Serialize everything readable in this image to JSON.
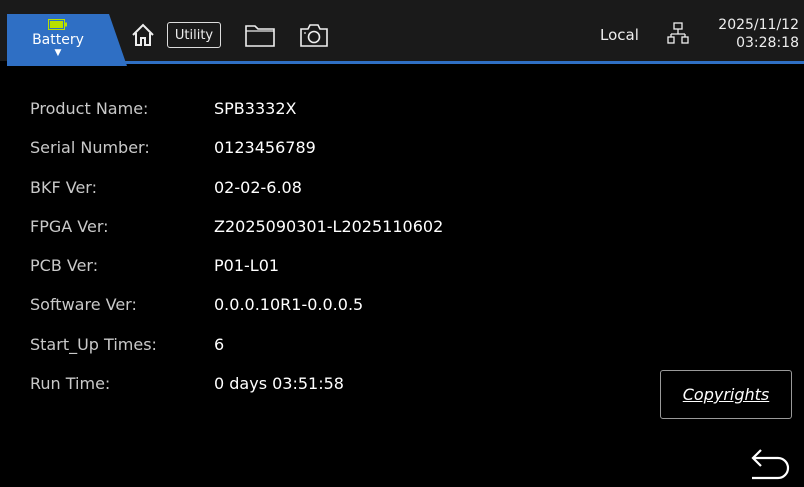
{
  "topbar": {
    "battery_label": "Battery",
    "utility_label": "Utility",
    "mode": "Local",
    "date": "2025/11/12",
    "time": "03:28:18",
    "icons": [
      "battery-icon",
      "home-icon",
      "folder-icon",
      "camera-icon",
      "network-icon"
    ],
    "accent_color": "#2f6fc4"
  },
  "info": [
    {
      "label": "Product Name:",
      "value": "SPB3332X"
    },
    {
      "label": "Serial Number:",
      "value": "0123456789"
    },
    {
      "label": "BKF Ver:",
      "value": "02-02-6.08"
    },
    {
      "label": "FPGA Ver:",
      "value": "Z2025090301-L2025110602"
    },
    {
      "label": "PCB Ver:",
      "value": "P01-L01"
    },
    {
      "label": "Software Ver:",
      "value": "0.0.0.10R1-0.0.0.5"
    },
    {
      "label": "Start_Up Times:",
      "value": "6"
    },
    {
      "label": "Run Time:",
      "value": "0 days 03:51:58"
    }
  ],
  "copyrights_label": "Copyrights",
  "back_icon": "back-arrow-icon"
}
